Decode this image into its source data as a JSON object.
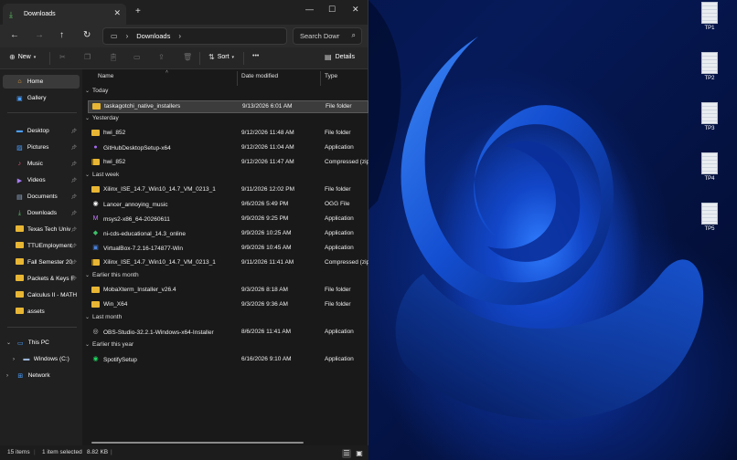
{
  "window": {
    "tab_title": "Downloads",
    "new_tab": "+",
    "close_tab": "✕"
  },
  "address": {
    "crumb": "Downloads",
    "search_placeholder": "Search Dowr"
  },
  "toolbar": {
    "new_label": "New",
    "sort_label": "Sort",
    "details_label": "Details",
    "more": "•••"
  },
  "sidebar": {
    "top": [
      {
        "label": "Home",
        "icon": "home-icon"
      },
      {
        "label": "Gallery",
        "icon": "gallery-icon"
      }
    ],
    "pinned": [
      {
        "label": "Desktop",
        "icon": "desktop-icon"
      },
      {
        "label": "Pictures",
        "icon": "pictures-icon"
      },
      {
        "label": "Music",
        "icon": "music-icon"
      },
      {
        "label": "Videos",
        "icon": "videos-icon"
      },
      {
        "label": "Documents",
        "icon": "documents-icon"
      },
      {
        "label": "Downloads",
        "icon": "downloads-icon"
      },
      {
        "label": "Texas Tech Univ",
        "icon": "folder-icon"
      },
      {
        "label": "TTUEmployment",
        "icon": "folder-icon"
      },
      {
        "label": "Fall Semester 20",
        "icon": "folder-icon"
      },
      {
        "label": "Packets & Keys F",
        "icon": "folder-icon"
      },
      {
        "label": "Calculus II - MATH",
        "icon": "folder-icon"
      },
      {
        "label": "assets",
        "icon": "folder-icon"
      }
    ],
    "tree": [
      {
        "label": "This PC",
        "icon": "pc-icon"
      },
      {
        "label": "Windows (C:)",
        "icon": "drive-icon"
      },
      {
        "label": "Network",
        "icon": "network-icon"
      }
    ]
  },
  "columns": {
    "name": "Name",
    "date": "Date modified",
    "type": "Type"
  },
  "groups": [
    {
      "label": "Today",
      "items": [
        {
          "name": "taskagotchi_native_installers",
          "date": "9/13/2026 6:01 AM",
          "type": "File folder",
          "icon": "folder",
          "selected": true
        }
      ]
    },
    {
      "label": "Yesterday",
      "items": [
        {
          "name": "hwi_852",
          "date": "9/12/2026 11:48 AM",
          "type": "File folder",
          "icon": "folder"
        },
        {
          "name": "GitHubDesktopSetup-x64",
          "date": "9/12/2026 11:04 AM",
          "type": "Application",
          "icon": "github"
        },
        {
          "name": "hwi_852",
          "date": "9/12/2026 11:47 AM",
          "type": "Compressed (zip",
          "icon": "zip"
        }
      ]
    },
    {
      "label": "Last week",
      "items": [
        {
          "name": "Xilinx_ISE_14.7_Win10_14.7_VM_0213_1",
          "date": "9/11/2026 12:02 PM",
          "type": "File folder",
          "icon": "folder"
        },
        {
          "name": "Lancer_annoying_music",
          "date": "9/6/2026 5:49 PM",
          "type": "OGG File",
          "icon": "audio"
        },
        {
          "name": "msys2-x86_64-20260611",
          "date": "9/9/2026 9:25 PM",
          "type": "Application",
          "icon": "msys"
        },
        {
          "name": "ni-cds-educational_14.3_online",
          "date": "9/9/2026 10:25 AM",
          "type": "Application",
          "icon": "ni"
        },
        {
          "name": "VirtualBox-7.2.16-174877-Win",
          "date": "9/9/2026 10:45 AM",
          "type": "Application",
          "icon": "vbox"
        },
        {
          "name": "Xilinx_ISE_14.7_Win10_14.7_VM_0213_1",
          "date": "9/11/2026 11:41 AM",
          "type": "Compressed (zip",
          "icon": "zip"
        }
      ]
    },
    {
      "label": "Earlier this month",
      "items": [
        {
          "name": "MobaXterm_Installer_v26.4",
          "date": "9/3/2026 8:18 AM",
          "type": "File folder",
          "icon": "folder"
        },
        {
          "name": "Win_X64",
          "date": "9/3/2026 9:36 AM",
          "type": "File folder",
          "icon": "folder"
        }
      ]
    },
    {
      "label": "Last month",
      "items": [
        {
          "name": "OBS-Studio-32.2.1-Windows-x64-Installer",
          "date": "8/6/2026 11:41 AM",
          "type": "Application",
          "icon": "obs"
        }
      ]
    },
    {
      "label": "Earlier this year",
      "items": [
        {
          "name": "SpotifySetup",
          "date": "6/16/2026 9:10 AM",
          "type": "Application",
          "icon": "spotify"
        }
      ]
    }
  ],
  "status": {
    "count": "15 items",
    "selected": "1 item selected",
    "size": "8.82 KB"
  },
  "desktop_icons": [
    "TP1",
    "TP2",
    "TP3",
    "TP4",
    "TP5"
  ],
  "colors": {
    "folder": "#e8b634",
    "accent": "#4ca0ff"
  }
}
